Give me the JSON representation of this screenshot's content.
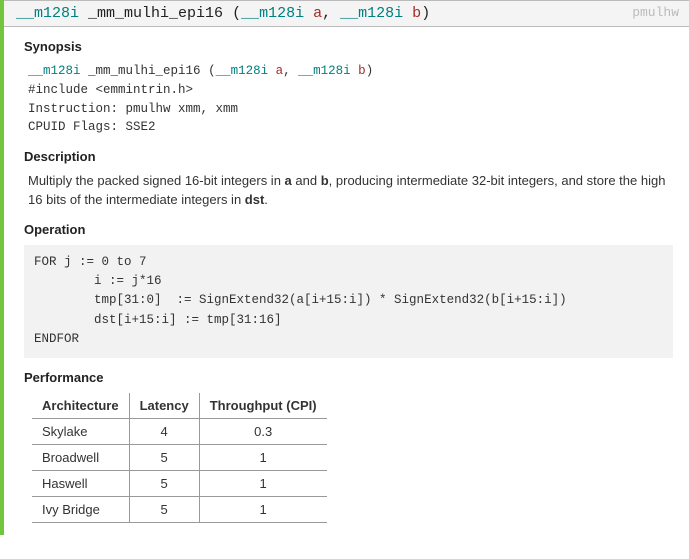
{
  "signature": {
    "return_type": "__m128i",
    "name": "_mm_mulhi_epi16",
    "params": [
      {
        "type": "__m128i",
        "name": "a"
      },
      {
        "type": "__m128i",
        "name": "b"
      }
    ],
    "instruction_mnemonic": "pmulhw"
  },
  "headings": {
    "synopsis": "Synopsis",
    "description": "Description",
    "operation": "Operation",
    "performance": "Performance"
  },
  "synopsis": {
    "sig_text_ret": "__m128i",
    "sig_text_name": "_mm_mulhi_epi16",
    "sig_text_p1_type": "__m128i",
    "sig_text_p1_name": "a",
    "sig_text_p2_type": "__m128i",
    "sig_text_p2_name": "b",
    "include": "#include <emmintrin.h>",
    "instruction": "Instruction: pmulhw xmm, xmm",
    "cpuid": "CPUID Flags: SSE2"
  },
  "description": {
    "pre_a": "Multiply the packed signed 16-bit integers in ",
    "arg_a": "a",
    "mid_ab": " and ",
    "arg_b": "b",
    "post_b": ", producing intermediate 32-bit integers, and store the high 16 bits of the intermediate integers in ",
    "dst": "dst",
    "tail": "."
  },
  "operation": "FOR j := 0 to 7\n        i := j*16\n        tmp[31:0]  := SignExtend32(a[i+15:i]) * SignExtend32(b[i+15:i])\n        dst[i+15:i] := tmp[31:16]\nENDFOR",
  "performance": {
    "columns": [
      "Architecture",
      "Latency",
      "Throughput (CPI)"
    ],
    "rows": [
      {
        "arch": "Skylake",
        "latency": "4",
        "throughput": "0.3"
      },
      {
        "arch": "Broadwell",
        "latency": "5",
        "throughput": "1"
      },
      {
        "arch": "Haswell",
        "latency": "5",
        "throughput": "1"
      },
      {
        "arch": "Ivy Bridge",
        "latency": "5",
        "throughput": "1"
      }
    ]
  }
}
